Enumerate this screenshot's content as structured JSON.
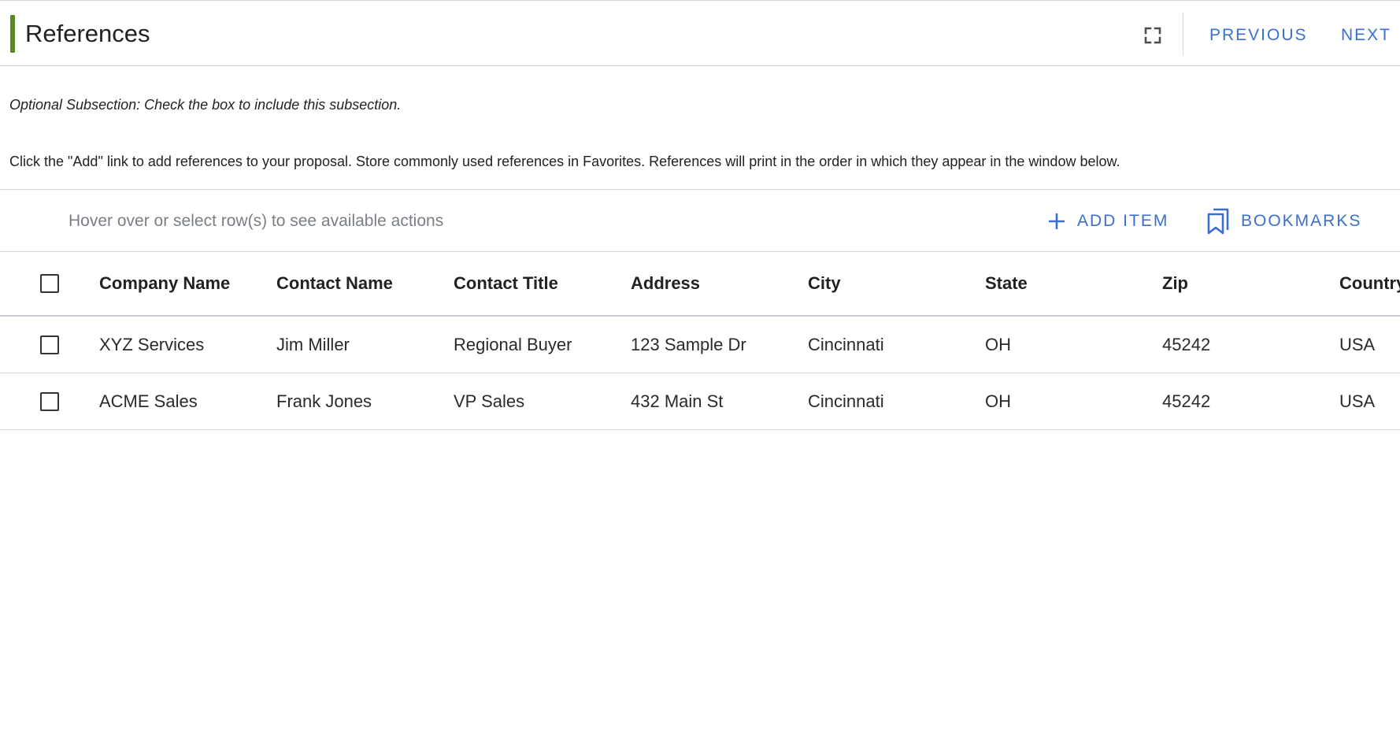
{
  "header": {
    "title": "References",
    "expand_icon": "fullscreen-icon",
    "previous_label": "PREVIOUS",
    "next_label": "NEXT",
    "accent_color": "#5b8a1f",
    "link_color": "#3a6fce"
  },
  "optional_note": "Optional Subsection: Check the box to include this subsection.",
  "instructions": "Click the \"Add\" link to add references to your proposal. Store commonly used references in Favorites. References will print in the order in which they appear in the window below.",
  "toolbar": {
    "hint": "Hover over or select row(s) to see available actions",
    "add_item_label": "ADD ITEM",
    "add_item_icon": "plus-icon",
    "bookmarks_label": "BOOKMARKS",
    "bookmarks_icon": "bookmarks-icon"
  },
  "table": {
    "columns": [
      "Company Name",
      "Contact Name",
      "Contact Title",
      "Address",
      "City",
      "State",
      "Zip",
      "Country"
    ],
    "rows": [
      [
        "XYZ Services",
        "Jim Miller",
        "Regional Buyer",
        "123 Sample Dr",
        "Cincinnati",
        "OH",
        "45242",
        "USA"
      ],
      [
        "ACME Sales",
        "Frank Jones",
        "VP Sales",
        "432 Main St",
        "Cincinnati",
        "OH",
        "45242",
        "USA"
      ]
    ]
  }
}
